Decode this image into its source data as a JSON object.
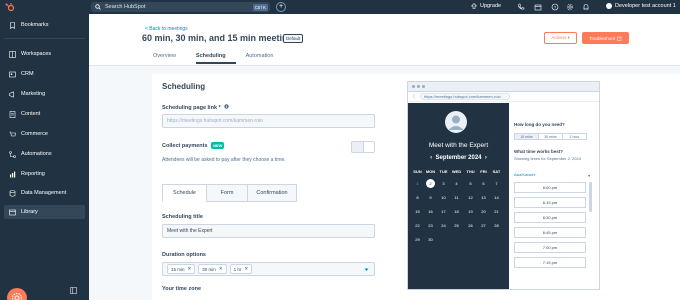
{
  "topbar": {
    "search_placeholder": "Search HubSpot",
    "search_shortcut": "Ctrl K",
    "upgrade_label": "Upgrade",
    "account_name": "Developer test account 1"
  },
  "sidebar": {
    "items": [
      {
        "label": "Bookmarks",
        "icon": "bookmark-icon"
      },
      {
        "label": "Workspaces",
        "icon": "workspace-icon"
      },
      {
        "label": "CRM",
        "icon": "crm-icon"
      },
      {
        "label": "Marketing",
        "icon": "marketing-icon"
      },
      {
        "label": "Content",
        "icon": "content-icon"
      },
      {
        "label": "Commerce",
        "icon": "commerce-icon"
      },
      {
        "label": "Automations",
        "icon": "automations-icon"
      },
      {
        "label": "Reporting",
        "icon": "reporting-icon"
      },
      {
        "label": "Data Management",
        "icon": "database-icon"
      },
      {
        "label": "Library",
        "icon": "library-icon"
      }
    ]
  },
  "header": {
    "back_link": "< Back to meetings",
    "title": "60 min, 30 min, and 15 min meeting",
    "badge": "Default",
    "actions_label": "Actions ▾",
    "troubleshoot_label": "Troubleshoot",
    "tabs": [
      "Overview",
      "Scheduling",
      "Automation"
    ]
  },
  "form": {
    "section_title": "Scheduling",
    "link_label": "Scheduling page link *",
    "link_value": "https://meetings.hubspot.com/kammen-roio",
    "collect_label": "Collect payments",
    "new_badge": "NEW",
    "collect_help": "Attendees will be asked to pay after they choose a time.",
    "subtabs": [
      "Schedule",
      "Form",
      "Confirmation"
    ],
    "title_label": "Scheduling title",
    "title_value": "Meet with the Expert",
    "duration_label": "Duration options",
    "durations": [
      "15 min",
      "30 min",
      "1 hr"
    ],
    "tz_label": "Your time zone"
  },
  "preview": {
    "url": "https://meetings.hubspot.com/kammen-roio",
    "meeting_name": "Meet with the Expert",
    "month": "September 2024",
    "weekdays": [
      "SUN",
      "MON",
      "TUE",
      "WED",
      "THU",
      "FRI",
      "SAT"
    ],
    "weeks": [
      [
        "1",
        "2",
        "3",
        "4",
        "5",
        "6",
        "7"
      ],
      [
        "8",
        "9",
        "10",
        "11",
        "12",
        "13",
        "14"
      ],
      [
        "15",
        "16",
        "17",
        "18",
        "19",
        "20",
        "21"
      ],
      [
        "22",
        "23",
        "24",
        "25",
        "26",
        "27",
        "28"
      ],
      [
        "29",
        "30",
        "",
        "",
        "",
        "",
        ""
      ]
    ],
    "selected_day": "2",
    "q_length": "How long do you need?",
    "duration_opts": [
      "15 mins",
      "30 mins",
      "1 hour"
    ],
    "q_time": "What time works best?",
    "showing": "Showing times for September 2, 2024",
    "timezone": "Asia/Karachi",
    "slots": [
      "6:00 pm",
      "6:15 pm",
      "6:30 pm",
      "6:45 pm",
      "7:00 pm",
      "7:15 pm"
    ]
  }
}
